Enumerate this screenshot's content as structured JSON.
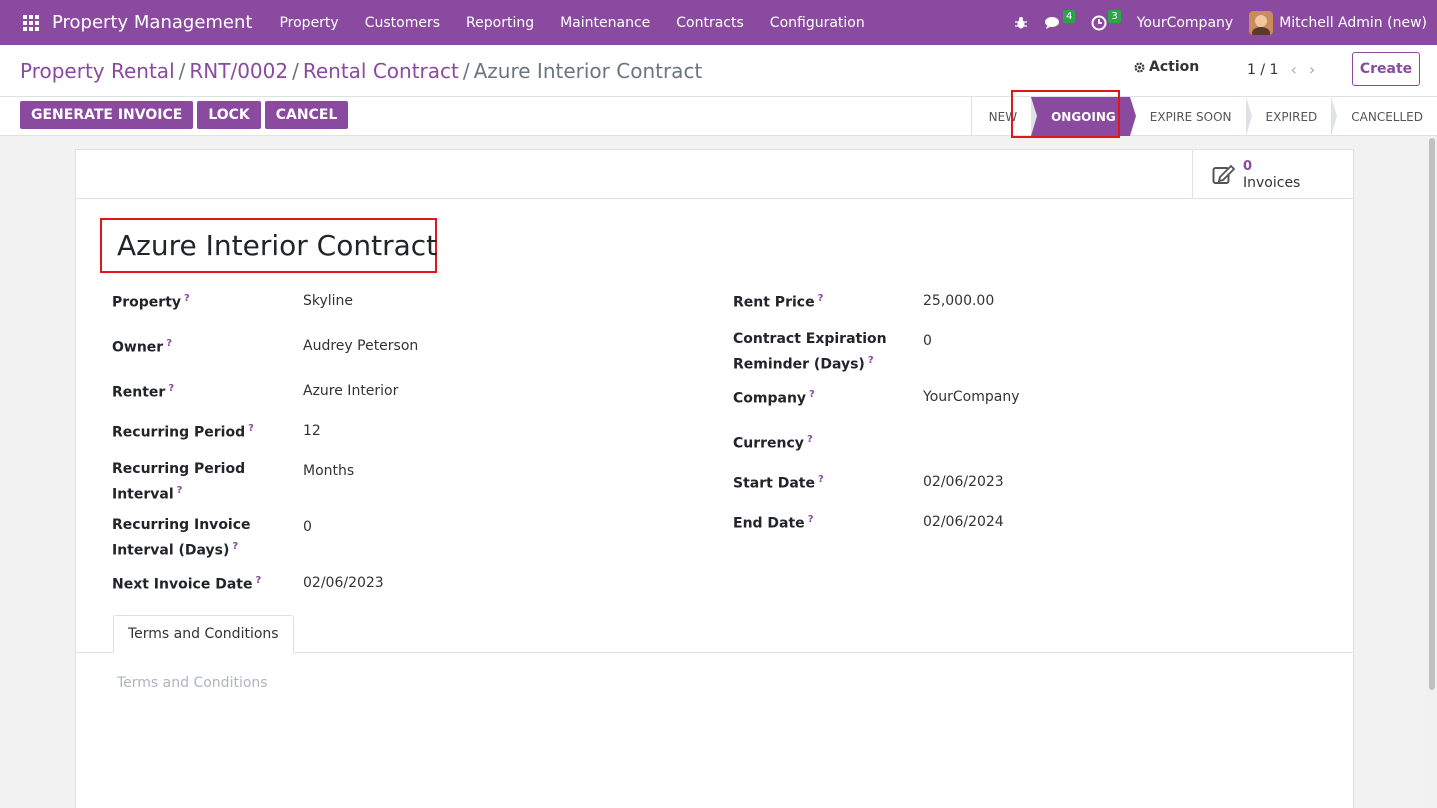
{
  "navbar": {
    "brand": "Property Management",
    "menu": [
      "Property",
      "Customers",
      "Reporting",
      "Maintenance",
      "Contracts",
      "Configuration"
    ],
    "messages_count": "4",
    "activities_count": "3",
    "company": "YourCompany",
    "user": "Mitchell Admin (new)"
  },
  "breadcrumb": {
    "items": [
      "Property Rental",
      "RNT/0002",
      "Rental Contract"
    ],
    "current": "Azure Interior Contract"
  },
  "control": {
    "action_label": "Action",
    "pager": "1 / 1",
    "create_label": "Create"
  },
  "buttons": [
    "GENERATE INVOICE",
    "LOCK",
    "CANCEL"
  ],
  "statusbar": {
    "stages": [
      "NEW",
      "ONGOING",
      "EXPIRE SOON",
      "EXPIRED",
      "CANCELLED"
    ],
    "active": "ONGOING"
  },
  "smart_button": {
    "count": "0",
    "label": "Invoices"
  },
  "record": {
    "title": "Azure Interior Contract",
    "left_fields": [
      {
        "label": "Property",
        "value": "Skyline"
      },
      {
        "label": "Owner",
        "value": "Audrey Peterson"
      },
      {
        "label": "Renter",
        "value": "Azure Interior"
      },
      {
        "label": "Recurring Period",
        "value": "12"
      },
      {
        "label": "Recurring Period Interval",
        "value": "Months"
      },
      {
        "label": "Recurring Invoice Interval (Days)",
        "value": "0"
      },
      {
        "label": "Next Invoice Date",
        "value": "02/06/2023"
      }
    ],
    "right_fields": [
      {
        "label": "Rent Price",
        "value": "25,000.00"
      },
      {
        "label": "Contract Expiration Reminder (Days)",
        "value": "0"
      },
      {
        "label": "Company",
        "value": "YourCompany"
      },
      {
        "label": "Currency",
        "value": ""
      },
      {
        "label": "Start Date",
        "value": "02/06/2023"
      },
      {
        "label": "End Date",
        "value": "02/06/2024"
      }
    ],
    "help_mark": "?"
  },
  "tabs": {
    "terms_tab": "Terms and Conditions",
    "terms_placeholder": "Terms and Conditions"
  },
  "colors": {
    "brand": "#8a4aa0",
    "highlight": "#e0161c",
    "badge": "#28a745"
  }
}
